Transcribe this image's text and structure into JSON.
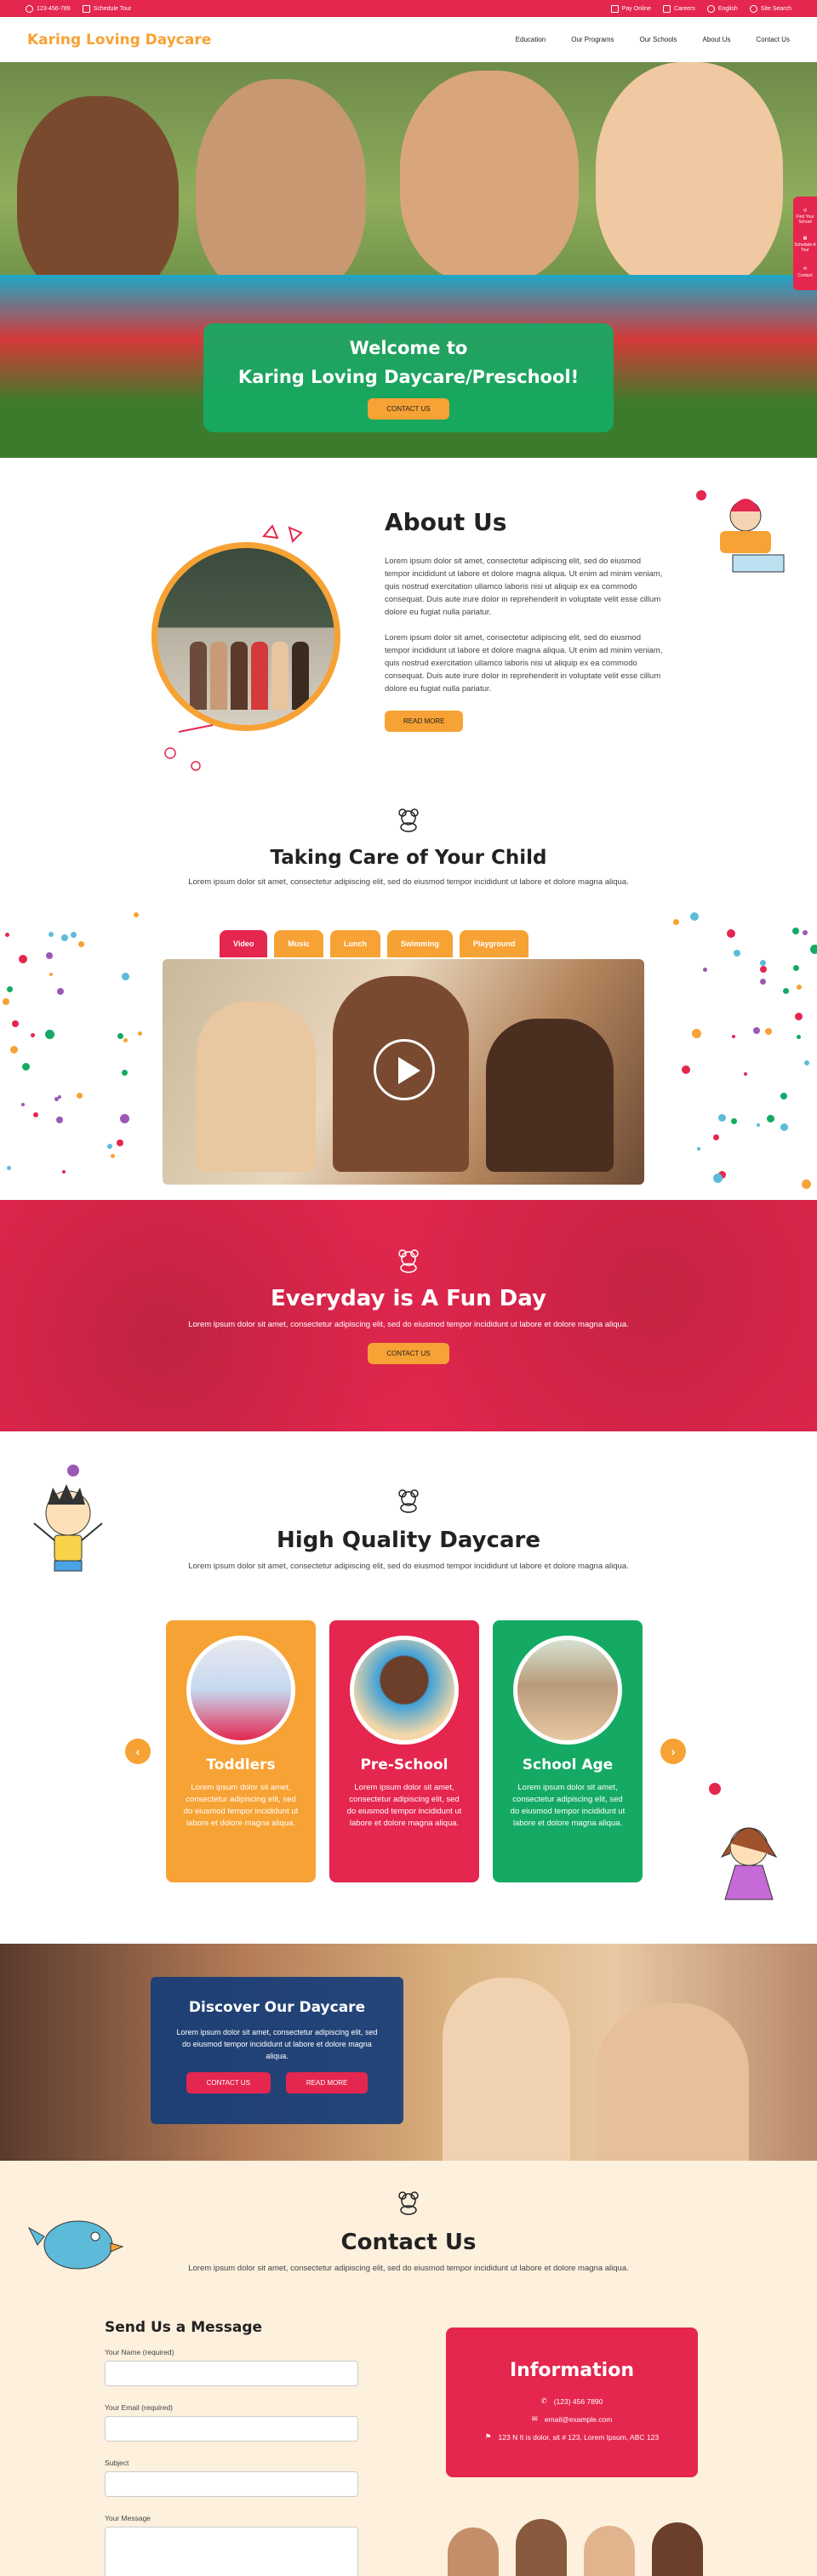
{
  "topbar": {
    "phone": "123-456-789",
    "schedule": "Schedule Tour",
    "pay": "Pay Online",
    "careers": "Careers",
    "language": "English",
    "search": "Site Search"
  },
  "header": {
    "logo": "Karing Loving Daycare",
    "nav": [
      "Education",
      "Our Programs",
      "Our Schools",
      "About Us",
      "Contact Us"
    ]
  },
  "hero": {
    "title_line1": "Welcome to",
    "title_line2": "Karing Loving Daycare/Preschool!",
    "button": "CONTACT US",
    "side_tabs": [
      "Find Your School",
      "Schedule A Tour",
      "Contact"
    ]
  },
  "about": {
    "title": "About Us",
    "para1": "Lorem ipsum dolor sit amet, consectetur adipiscing elit, sed do eiusmod tempor incididunt ut labore et dolore magna aliqua. Ut enim ad minim veniam, quis nostrud exercitation ullamco laboris nisi ut aliquip ex ea commodo consequat. Duis aute irure dolor in reprehenderit in voluptate velit esse cillum dolore eu fugiat nulla pariatur.",
    "para2": "Lorem ipsum dolor sit amet, consectetur adipiscing elit, sed do eiusmod tempor incididunt ut labore et dolore magna aliqua. Ut enim ad minim veniam, quis nostrud exercitation ullamco laboris nisi ut aliquip ex ea commodo consequat. Duis aute irure dolor in reprehenderit in voluptate velit esse cillum dolore eu fugiat nulla pariatur.",
    "button": "READ MORE"
  },
  "care": {
    "title": "Taking Care of Your Child",
    "text": "Lorem ipsum dolor sit amet, consectetur adipiscing elit, sed do eiusmod tempor incididunt ut labore et dolore magna aliqua.",
    "tabs": [
      "Video",
      "Music",
      "Lunch",
      "Swimming",
      "Playground"
    ]
  },
  "fun": {
    "title": "Everyday is A Fun Day",
    "text": "Lorem ipsum dolor sit amet, consectetur adipiscing elit, sed do eiusmod tempor incididunt ut labore et dolore magna aliqua.",
    "button": "CONTACT US"
  },
  "quality": {
    "title": "High Quality Daycare",
    "text": "Lorem ipsum dolor sit amet, consectetur adipiscing elit, sed do eiusmod tempor incididunt ut labore et dolore magna aliqua.",
    "cards": [
      {
        "title": "Toddlers",
        "text": "Lorem ipsum dolor sit amet, consectetur adipiscing elit, sed do eiusmod tempor incididunt ut labore et dolore magna aliqua.",
        "color": "#f7a234"
      },
      {
        "title": "Pre-School",
        "text": "Lorem ipsum dolor sit amet, consectetur adipiscing elit, sed do eiusmod tempor incididunt ut labore et dolore magna aliqua.",
        "color": "#e5264f"
      },
      {
        "title": "School Age",
        "text": "Lorem ipsum dolor sit amet, consectetur adipiscing elit, sed do eiusmod tempor incididunt ut labore et dolore magna aliqua.",
        "color": "#15aa64"
      }
    ]
  },
  "discover": {
    "title": "Discover Our Daycare",
    "text": "Lorem ipsum dolor sit amet, consectetur adipiscing elit, sed do eiusmod tempor incididunt ut labore et dolore magna aliqua.",
    "btn1": "CONTACT US",
    "btn2": "READ MORE"
  },
  "contact": {
    "title": "Contact Us",
    "text": "Lorem ipsum dolor sit amet, consectetur adipiscing elit, sed do eiusmod tempor incididunt ut labore et dolore magna aliqua.",
    "form_title": "Send Us a Message",
    "name_label": "Your Name (required)",
    "email_label": "Your Email (required)",
    "subject_label": "Subject",
    "message_label": "Your Message",
    "info_title": "Information",
    "phone": "(123) 456 7890",
    "email": "email@example.com",
    "address": "123 N It is dolor, sit # 123, Lorem Ipsum, ABC 123"
  },
  "colors": {
    "red": "#e5264f",
    "orange": "#f7a234",
    "green": "#15aa64",
    "navy": "#153d78",
    "cream": "#fdf0dd"
  }
}
